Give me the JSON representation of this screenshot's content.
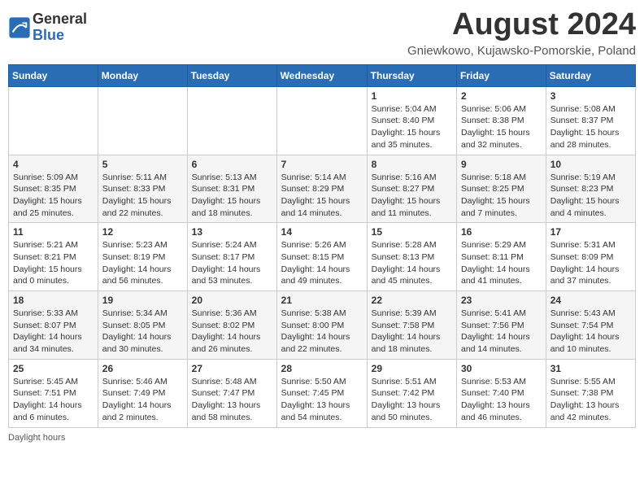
{
  "header": {
    "logo_general": "General",
    "logo_blue": "Blue",
    "month_year": "August 2024",
    "location": "Gniewkowo, Kujawsko-Pomorskie, Poland"
  },
  "days_of_week": [
    "Sunday",
    "Monday",
    "Tuesday",
    "Wednesday",
    "Thursday",
    "Friday",
    "Saturday"
  ],
  "weeks": [
    [
      {
        "day": "",
        "info": ""
      },
      {
        "day": "",
        "info": ""
      },
      {
        "day": "",
        "info": ""
      },
      {
        "day": "",
        "info": ""
      },
      {
        "day": "1",
        "info": "Sunrise: 5:04 AM\nSunset: 8:40 PM\nDaylight: 15 hours\nand 35 minutes."
      },
      {
        "day": "2",
        "info": "Sunrise: 5:06 AM\nSunset: 8:38 PM\nDaylight: 15 hours\nand 32 minutes."
      },
      {
        "day": "3",
        "info": "Sunrise: 5:08 AM\nSunset: 8:37 PM\nDaylight: 15 hours\nand 28 minutes."
      }
    ],
    [
      {
        "day": "4",
        "info": "Sunrise: 5:09 AM\nSunset: 8:35 PM\nDaylight: 15 hours\nand 25 minutes."
      },
      {
        "day": "5",
        "info": "Sunrise: 5:11 AM\nSunset: 8:33 PM\nDaylight: 15 hours\nand 22 minutes."
      },
      {
        "day": "6",
        "info": "Sunrise: 5:13 AM\nSunset: 8:31 PM\nDaylight: 15 hours\nand 18 minutes."
      },
      {
        "day": "7",
        "info": "Sunrise: 5:14 AM\nSunset: 8:29 PM\nDaylight: 15 hours\nand 14 minutes."
      },
      {
        "day": "8",
        "info": "Sunrise: 5:16 AM\nSunset: 8:27 PM\nDaylight: 15 hours\nand 11 minutes."
      },
      {
        "day": "9",
        "info": "Sunrise: 5:18 AM\nSunset: 8:25 PM\nDaylight: 15 hours\nand 7 minutes."
      },
      {
        "day": "10",
        "info": "Sunrise: 5:19 AM\nSunset: 8:23 PM\nDaylight: 15 hours\nand 4 minutes."
      }
    ],
    [
      {
        "day": "11",
        "info": "Sunrise: 5:21 AM\nSunset: 8:21 PM\nDaylight: 15 hours\nand 0 minutes."
      },
      {
        "day": "12",
        "info": "Sunrise: 5:23 AM\nSunset: 8:19 PM\nDaylight: 14 hours\nand 56 minutes."
      },
      {
        "day": "13",
        "info": "Sunrise: 5:24 AM\nSunset: 8:17 PM\nDaylight: 14 hours\nand 53 minutes."
      },
      {
        "day": "14",
        "info": "Sunrise: 5:26 AM\nSunset: 8:15 PM\nDaylight: 14 hours\nand 49 minutes."
      },
      {
        "day": "15",
        "info": "Sunrise: 5:28 AM\nSunset: 8:13 PM\nDaylight: 14 hours\nand 45 minutes."
      },
      {
        "day": "16",
        "info": "Sunrise: 5:29 AM\nSunset: 8:11 PM\nDaylight: 14 hours\nand 41 minutes."
      },
      {
        "day": "17",
        "info": "Sunrise: 5:31 AM\nSunset: 8:09 PM\nDaylight: 14 hours\nand 37 minutes."
      }
    ],
    [
      {
        "day": "18",
        "info": "Sunrise: 5:33 AM\nSunset: 8:07 PM\nDaylight: 14 hours\nand 34 minutes."
      },
      {
        "day": "19",
        "info": "Sunrise: 5:34 AM\nSunset: 8:05 PM\nDaylight: 14 hours\nand 30 minutes."
      },
      {
        "day": "20",
        "info": "Sunrise: 5:36 AM\nSunset: 8:02 PM\nDaylight: 14 hours\nand 26 minutes."
      },
      {
        "day": "21",
        "info": "Sunrise: 5:38 AM\nSunset: 8:00 PM\nDaylight: 14 hours\nand 22 minutes."
      },
      {
        "day": "22",
        "info": "Sunrise: 5:39 AM\nSunset: 7:58 PM\nDaylight: 14 hours\nand 18 minutes."
      },
      {
        "day": "23",
        "info": "Sunrise: 5:41 AM\nSunset: 7:56 PM\nDaylight: 14 hours\nand 14 minutes."
      },
      {
        "day": "24",
        "info": "Sunrise: 5:43 AM\nSunset: 7:54 PM\nDaylight: 14 hours\nand 10 minutes."
      }
    ],
    [
      {
        "day": "25",
        "info": "Sunrise: 5:45 AM\nSunset: 7:51 PM\nDaylight: 14 hours\nand 6 minutes."
      },
      {
        "day": "26",
        "info": "Sunrise: 5:46 AM\nSunset: 7:49 PM\nDaylight: 14 hours\nand 2 minutes."
      },
      {
        "day": "27",
        "info": "Sunrise: 5:48 AM\nSunset: 7:47 PM\nDaylight: 13 hours\nand 58 minutes."
      },
      {
        "day": "28",
        "info": "Sunrise: 5:50 AM\nSunset: 7:45 PM\nDaylight: 13 hours\nand 54 minutes."
      },
      {
        "day": "29",
        "info": "Sunrise: 5:51 AM\nSunset: 7:42 PM\nDaylight: 13 hours\nand 50 minutes."
      },
      {
        "day": "30",
        "info": "Sunrise: 5:53 AM\nSunset: 7:40 PM\nDaylight: 13 hours\nand 46 minutes."
      },
      {
        "day": "31",
        "info": "Sunrise: 5:55 AM\nSunset: 7:38 PM\nDaylight: 13 hours\nand 42 minutes."
      }
    ]
  ],
  "footer": {
    "daylight_label": "Daylight hours"
  }
}
